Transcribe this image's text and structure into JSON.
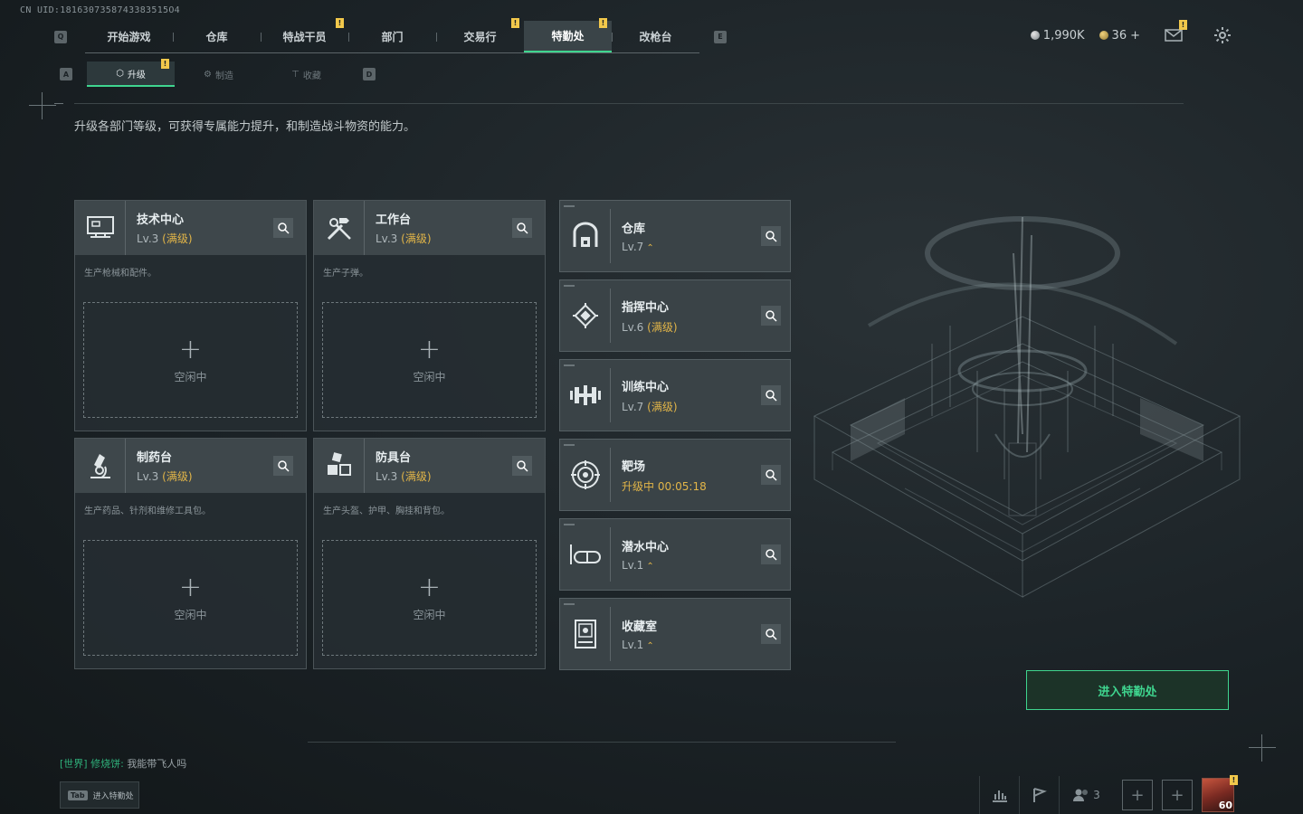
{
  "uid": "CN UID:1816307358743383515O4",
  "topnav": {
    "left_key": "Q",
    "right_key": "E",
    "tabs": [
      {
        "label": "开始游戏",
        "alert": false
      },
      {
        "label": "仓库",
        "alert": false
      },
      {
        "label": "特战干员",
        "alert": true
      },
      {
        "label": "部门",
        "alert": false
      },
      {
        "label": "交易行",
        "alert": true
      },
      {
        "label": "特勤处",
        "alert": true,
        "active": true
      },
      {
        "label": "改枪台",
        "alert": false
      }
    ]
  },
  "currency": {
    "silver": "1,990K",
    "gold": "36",
    "gold_add": "+"
  },
  "subnav": {
    "left_key": "A",
    "right_key": "D",
    "tabs": [
      {
        "label": "升级",
        "active": true,
        "alert": true
      },
      {
        "label": "制造",
        "active": false
      },
      {
        "label": "收藏",
        "active": false
      }
    ]
  },
  "description": "升级各部门等级，可获得专属能力提升，和制造战斗物资的能力。",
  "production_cards": [
    {
      "name": "技术中心",
      "level": "Lv.3",
      "max": "(满级)",
      "desc": "生产枪械和配件。",
      "idle": "空闲中",
      "icon": "computer-icon"
    },
    {
      "name": "工作台",
      "level": "Lv.3",
      "max": "(满级)",
      "desc": "生产子弹。",
      "idle": "空闲中",
      "icon": "tools-icon"
    },
    {
      "name": "制药台",
      "level": "Lv.3",
      "max": "(满级)",
      "desc": "生产药品、针剂和维修工具包。",
      "idle": "空闲中",
      "icon": "microscope-icon"
    },
    {
      "name": "防具台",
      "level": "Lv.3",
      "max": "(满级)",
      "desc": "生产头盔、护甲、胸挂和背包。",
      "idle": "空闲中",
      "icon": "armor-icon"
    }
  ],
  "facilities": [
    {
      "name": "仓库",
      "level": "Lv.7",
      "status": "",
      "upgradable": true,
      "icon": "warehouse-icon"
    },
    {
      "name": "指挥中心",
      "level": "Lv.6",
      "status": "(满级)",
      "upgradable": false,
      "icon": "command-icon"
    },
    {
      "name": "训练中心",
      "level": "Lv.7",
      "status": "(满级)",
      "upgradable": false,
      "icon": "dumbbell-icon"
    },
    {
      "name": "靶场",
      "level": "升级中 00:05:18",
      "status": "",
      "upgradable": false,
      "icon": "target-icon"
    },
    {
      "name": "潜水中心",
      "level": "Lv.1",
      "status": "",
      "upgradable": true,
      "icon": "diving-icon"
    },
    {
      "name": "收藏室",
      "level": "Lv.1",
      "status": "",
      "upgradable": true,
      "icon": "collection-icon"
    }
  ],
  "enter_button": "进入特勤处",
  "chat": {
    "channel": "[世界]",
    "user": "修烧饼:",
    "message": "我能带飞人吗"
  },
  "tab_hint": {
    "key": "Tab",
    "label": "进入特勤处"
  },
  "bottom": {
    "friends_count": "3",
    "player_level": "60"
  },
  "colors": {
    "accent": "#3fd58f",
    "max_level": "#e2b548",
    "alert": "#f2c84b"
  }
}
